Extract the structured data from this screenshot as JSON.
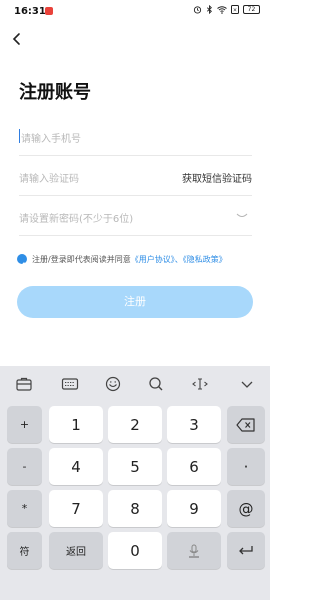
{
  "status": {
    "time": "16:31",
    "battery": "72"
  },
  "page": {
    "title": "注册账号",
    "phone_placeholder": "请输入手机号",
    "code_placeholder": "请输入验证码",
    "get_code": "获取短信验证码",
    "password_placeholder": "请设置新密码(不少于6位)",
    "agree_prefix": "注册/登录即代表阅读并同意",
    "user_agreement": "《用户协议》",
    "separator": "、",
    "privacy_policy": "《隐私政策》",
    "register_label": "注册"
  },
  "keyboard": {
    "toolbar_icons": [
      "briefcase-icon",
      "keyboard-icon",
      "emoji-icon",
      "search-icon",
      "cursor-move-icon",
      "chevron-down-icon"
    ],
    "symbols": [
      "+",
      "-",
      "*",
      "/"
    ],
    "digits": [
      "1",
      "2",
      "3",
      "4",
      "5",
      "6",
      "7",
      "8",
      "9",
      "0"
    ],
    "dot": "·",
    "at": "@",
    "fu": "符",
    "back": "返回"
  },
  "colors": {
    "accent": "#2f8ee6",
    "button_disabled": "#a8d8fb",
    "keyboard_bg": "#e6e7eb"
  }
}
